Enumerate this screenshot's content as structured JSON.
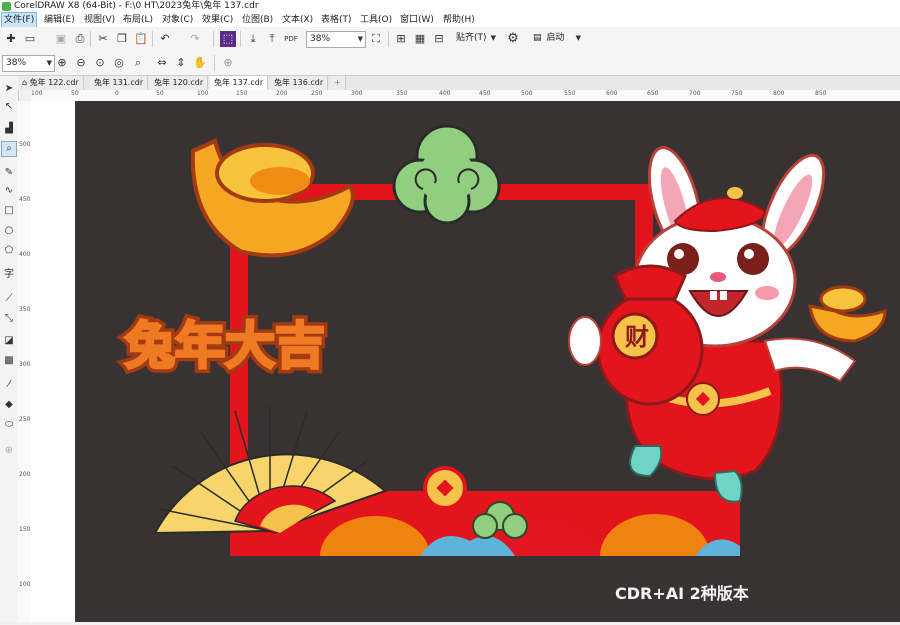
{
  "app": {
    "title": "CorelDRAW X8 (64-Bit) - F:\\0 HT\\2023兔年\\兔年 137.cdr"
  },
  "menu": [
    "文件(F)",
    "编辑(E)",
    "视图(V)",
    "布局(L)",
    "对象(C)",
    "效果(C)",
    "位图(B)",
    "文本(X)",
    "表格(T)",
    "工具(O)",
    "窗口(W)",
    "帮助(H)"
  ],
  "toolbar": {
    "zoom_value": "38%",
    "snap_label": "贴齐(T)",
    "launch_label": "启动"
  },
  "property_bar": {
    "zoom_value": "38%"
  },
  "tabs": [
    {
      "label": "兔年 122.cdr",
      "active": false
    },
    {
      "label": "兔年 131.cdr",
      "active": false
    },
    {
      "label": "兔年 120.cdr",
      "active": false
    },
    {
      "label": "兔年 137.cdr",
      "active": true
    },
    {
      "label": "兔年 136.cdr",
      "active": false
    }
  ],
  "ruler": {
    "h_ticks": [
      "100",
      "50",
      "0",
      "50",
      "100",
      "150",
      "200",
      "250",
      "300",
      "350",
      "400",
      "450",
      "500",
      "550",
      "600",
      "650",
      "700",
      "750",
      "800",
      "850"
    ],
    "v_ticks": [
      "500",
      "450",
      "400",
      "350",
      "300",
      "250",
      "200",
      "150",
      "100"
    ]
  },
  "artwork": {
    "slogan": "兔年大吉",
    "bag_character": "财",
    "watermark": "CDR+AI 2种版本"
  },
  "colors": {
    "page_bg": "#383232",
    "frame_red": "#e3141b",
    "gold": "#f6c34a",
    "cloud_green": "#8fcf7e"
  }
}
